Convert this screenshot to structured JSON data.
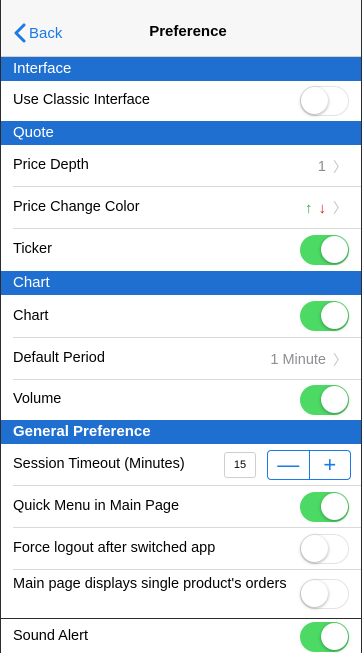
{
  "nav": {
    "back_label": "Back",
    "title": "Preference"
  },
  "sections": {
    "interface": "Interface",
    "quote": "Quote",
    "chart": "Chart",
    "general": "General Preference"
  },
  "rows": {
    "classic_interface": {
      "label": "Use Classic Interface",
      "enabled": false
    },
    "price_depth": {
      "label": "Price Depth",
      "value": "1"
    },
    "price_change_color": {
      "label": "Price Change Color",
      "up_symbol": "↑",
      "down_symbol": "↓",
      "up_color": "#2ea84a",
      "down_color": "#e0201c"
    },
    "ticker": {
      "label": "Ticker",
      "enabled": true
    },
    "chart": {
      "label": "Chart",
      "enabled": true
    },
    "default_period": {
      "label": "Default Period",
      "value": "1 Minute"
    },
    "volume": {
      "label": "Volume",
      "enabled": true
    },
    "session_timeout": {
      "label": "Session Timeout (Minutes)",
      "value": "15",
      "decrement": "—",
      "increment": "+"
    },
    "quick_menu": {
      "label": "Quick Menu in Main Page",
      "enabled": true
    },
    "force_logout": {
      "label": "Force logout after switched app",
      "enabled": false
    },
    "single_product_orders": {
      "label": "Main page displays single product's orders",
      "enabled": false
    },
    "sound_alert": {
      "label": "Sound Alert",
      "enabled": true
    }
  },
  "icons": {
    "back": "chevron-left-icon",
    "disclosure": "chevron-right-icon"
  },
  "colors": {
    "accent": "#1a7ae8",
    "section_header": "#1f6fd1",
    "toggle_on": "#4cd964"
  },
  "disclosure_glyph": "〉"
}
